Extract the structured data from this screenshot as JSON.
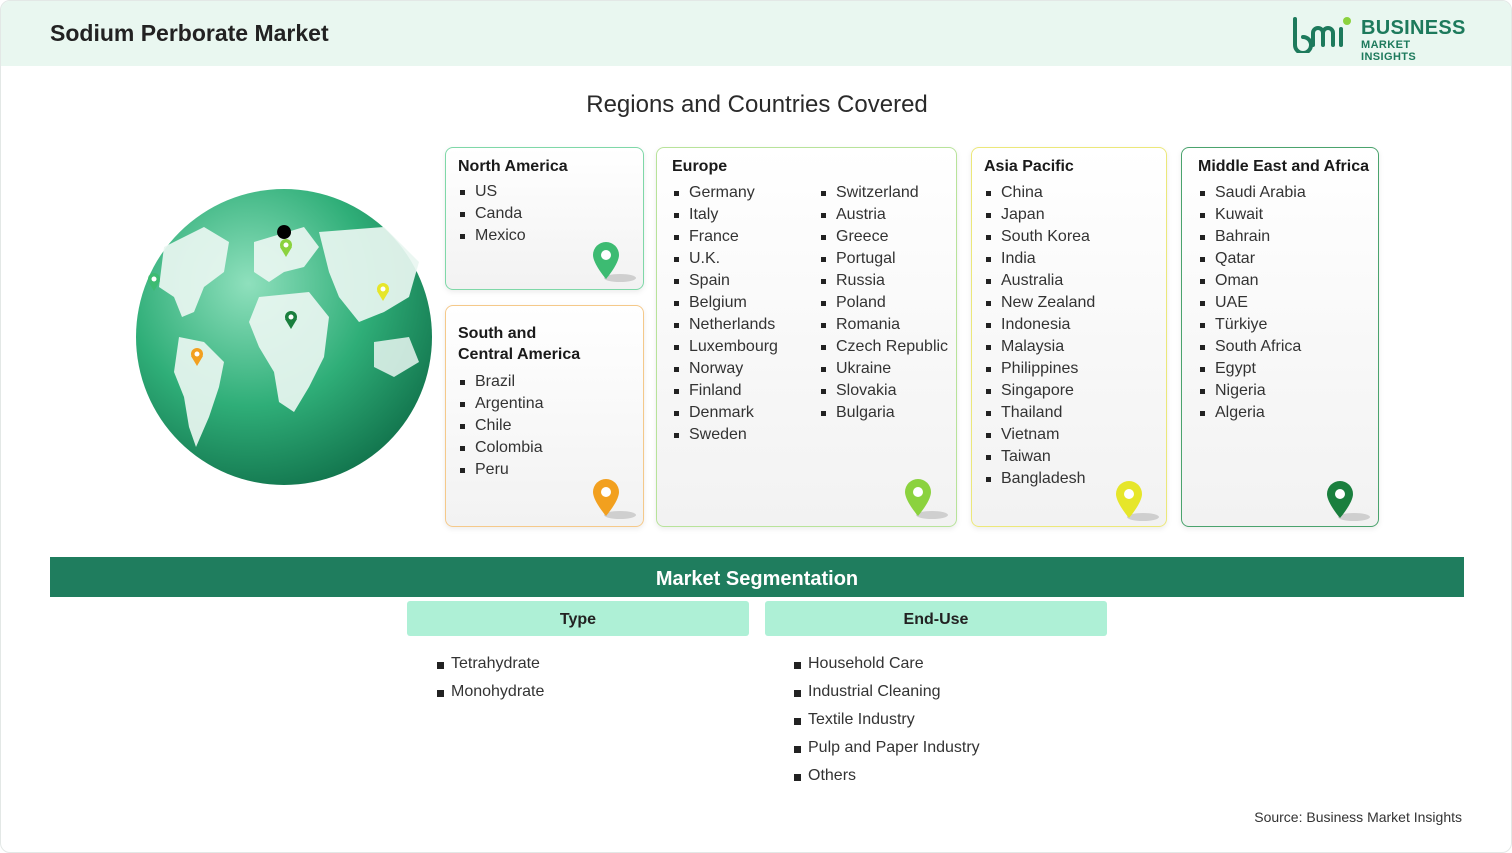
{
  "header": {
    "title": "Sodium Perborate Market"
  },
  "logo": {
    "line1": "BUSINESS",
    "line2": "MARKET INSIGHTS",
    "mark": "bmi"
  },
  "regions_title": "Regions and Countries Covered",
  "regions": {
    "north_america": {
      "title": "North America",
      "countries": [
        "US",
        "Canda",
        "Mexico"
      ],
      "pin_color": "#3dbb72"
    },
    "south_central_america": {
      "title_line1": "South and",
      "title_line2": "Central America",
      "countries": [
        "Brazil",
        "Argentina",
        "Chile",
        "Colombia",
        "Peru"
      ],
      "pin_color": "#f2a01f"
    },
    "europe": {
      "title": "Europe",
      "countries_col1": [
        "Germany",
        "Italy",
        "France",
        "U.K.",
        "Spain",
        "Belgium",
        "Netherlands",
        "Luxembourg",
        "Norway",
        "Finland",
        "Denmark",
        "Sweden"
      ],
      "countries_col2": [
        "Switzerland",
        "Austria",
        "Greece",
        "Portugal",
        "Russia",
        "Poland",
        "Romania",
        "Czech Republic",
        "Ukraine",
        "Slovakia",
        "Bulgaria"
      ],
      "pin_color": "#8bd23e"
    },
    "asia_pacific": {
      "title": "Asia Pacific",
      "countries": [
        "China",
        "Japan",
        "South Korea",
        "India",
        "Australia",
        "New Zealand",
        "Indonesia",
        "Malaysia",
        "Philippines",
        "Singapore",
        "Thailand",
        "Vietnam",
        "Taiwan",
        "Bangladesh"
      ],
      "pin_color": "#e6e62a"
    },
    "middle_east_africa": {
      "title": "Middle East and Africa",
      "countries": [
        "Saudi Arabia",
        "Kuwait",
        "Bahrain",
        "Qatar",
        "Oman",
        "UAE",
        "Türkiye",
        "South Africa",
        "Egypt",
        "Nigeria",
        "Algeria"
      ],
      "pin_color": "#1a7f3e"
    }
  },
  "segmentation": {
    "title": "Market Segmentation",
    "type": {
      "label": "Type",
      "items": [
        "Tetrahydrate",
        "Monohydrate"
      ]
    },
    "end_use": {
      "label": "End-Use",
      "items": [
        "Household Care",
        "Industrial Cleaning",
        "Textile Industry",
        "Pulp and Paper Industry",
        "Others"
      ]
    }
  },
  "source": "Source: Business Market Insights",
  "colors": {
    "header_bg": "#e9f7f0",
    "brand_green": "#1f7d5e",
    "tab_bg": "#aef0d6"
  }
}
